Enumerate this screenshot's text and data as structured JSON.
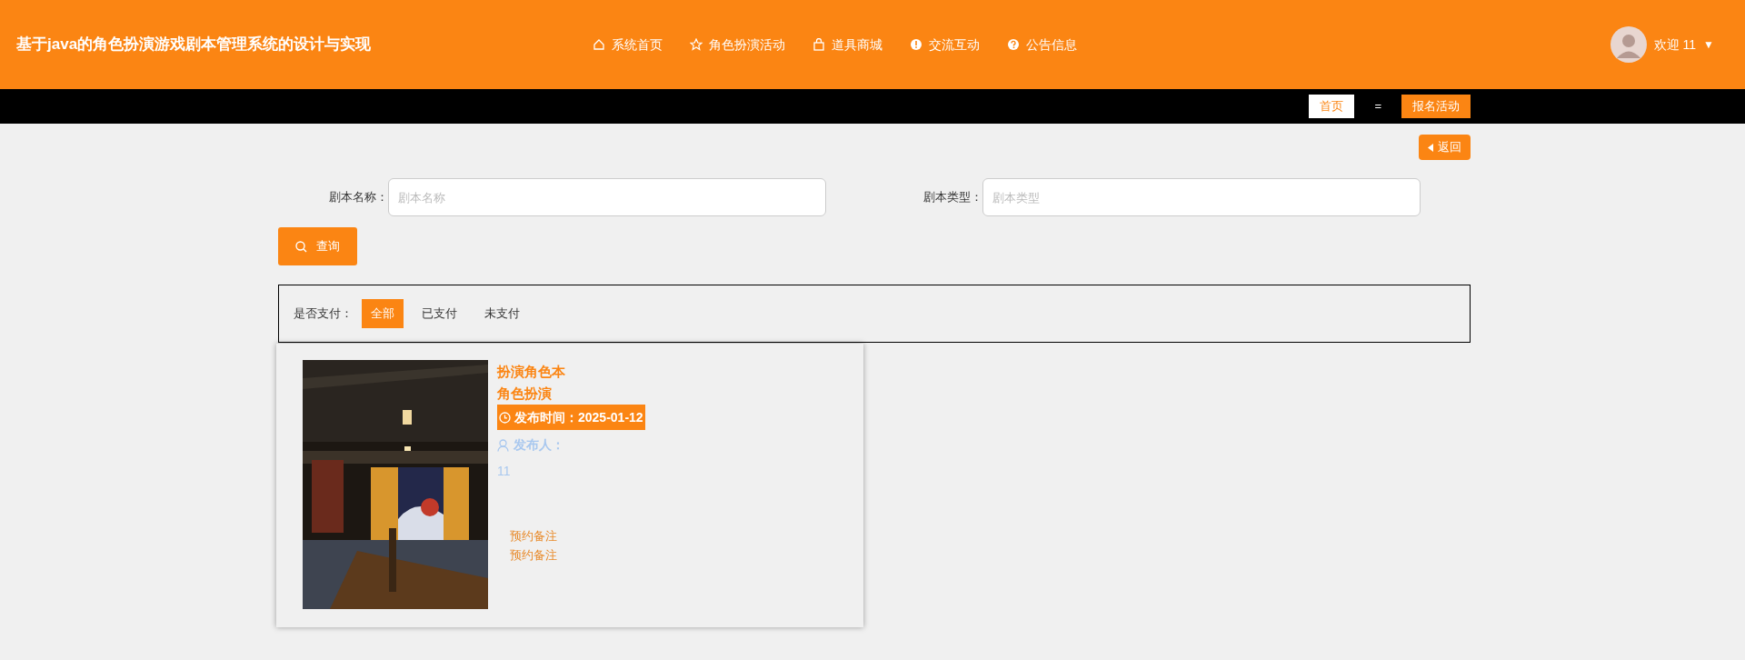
{
  "header": {
    "title": "基于java的角色扮演游戏剧本管理系统的设计与实现",
    "nav": [
      {
        "label": "系统首页"
      },
      {
        "label": "角色扮演活动"
      },
      {
        "label": "道具商城"
      },
      {
        "label": "交流互动"
      },
      {
        "label": "公告信息"
      }
    ],
    "user": {
      "greeting": "欢迎 11",
      "caret": "▼"
    }
  },
  "breadcrumb": [
    {
      "label": "首页",
      "selected": false
    },
    {
      "label": "报名活动",
      "selected": true
    }
  ],
  "breadcrumb_separator": "=",
  "back_button": "返回",
  "search": {
    "fields": [
      {
        "label": "剧本名称：",
        "placeholder": "剧本名称"
      },
      {
        "label": "剧本类型：",
        "placeholder": "剧本类型"
      }
    ],
    "button": "查询"
  },
  "filter": {
    "label": "是否支付：",
    "options": [
      {
        "label": "全部",
        "selected": true
      },
      {
        "label": "已支付",
        "selected": false
      },
      {
        "label": "未支付",
        "selected": false
      }
    ]
  },
  "cards": [
    {
      "kind": "picture",
      "title": "扮演角色本",
      "type": "角色扮演",
      "time": "发布时间：2025-01-12",
      "publisher_label": "发布人：",
      "publisher": "11",
      "notes": [
        "预约备注",
        "预约备注"
      ]
    }
  ]
}
